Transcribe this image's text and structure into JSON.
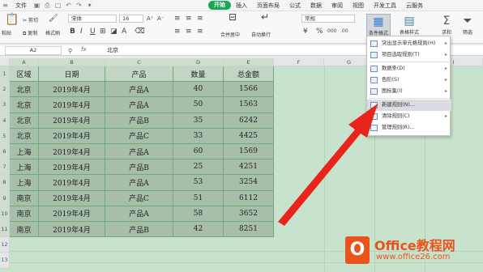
{
  "menubar": {
    "file": "文件",
    "items": [
      "开始",
      "插入",
      "页面布局",
      "公式",
      "数据",
      "审阅",
      "视图",
      "开发工具",
      "云服务"
    ],
    "active_index": 0
  },
  "ribbon": {
    "cut": "剪切",
    "paste": "粘贴",
    "copy": "复制",
    "format_painter": "格式刷",
    "font": "宋体",
    "font_size": "16",
    "merge": "合并居中",
    "wrap": "自动换行",
    "number_format": "常规",
    "conditional_format": "条件格式",
    "table_style": "表格样式",
    "sum": "求和",
    "filter": "筛选"
  },
  "formula_bar": {
    "cell_ref": "A2",
    "fx": "fx",
    "value": "北京"
  },
  "columns": [
    "A",
    "B",
    "C",
    "D",
    "E",
    "F",
    "G",
    "H",
    "I"
  ],
  "rows": [
    "1",
    "2",
    "3",
    "4",
    "5",
    "6",
    "7",
    "8",
    "9",
    "10",
    "11",
    "12",
    "13"
  ],
  "table": {
    "headers": [
      "区域",
      "日期",
      "产品",
      "数量",
      "总金额"
    ],
    "rows": [
      [
        "北京",
        "2019年4月",
        "产品A",
        "40",
        "1566"
      ],
      [
        "北京",
        "2019年4月",
        "产品A",
        "50",
        "1563"
      ],
      [
        "北京",
        "2019年4月",
        "产品B",
        "35",
        "6242"
      ],
      [
        "北京",
        "2019年4月",
        "产品C",
        "33",
        "4425"
      ],
      [
        "上海",
        "2019年4月",
        "产品A",
        "60",
        "1569"
      ],
      [
        "上海",
        "2019年4月",
        "产品B",
        "25",
        "4251"
      ],
      [
        "上海",
        "2019年4月",
        "产品A",
        "53",
        "3254"
      ],
      [
        "南京",
        "2019年4月",
        "产品C",
        "51",
        "6112"
      ],
      [
        "南京",
        "2019年4月",
        "产品A",
        "58",
        "3652"
      ],
      [
        "南京",
        "2019年4月",
        "产品B",
        "42",
        "8251"
      ]
    ]
  },
  "dropdown": {
    "items": [
      {
        "label": "突出显示单元格规则(H)",
        "submenu": true
      },
      {
        "label": "项目选取规则(T)",
        "submenu": true
      },
      {
        "label": "数据条(D)",
        "submenu": true
      },
      {
        "label": "色阶(S)",
        "submenu": true
      },
      {
        "label": "图标集(I)",
        "submenu": true
      },
      {
        "label": "新建规则(N)...",
        "submenu": false
      },
      {
        "label": "清除规则(C)",
        "submenu": true
      },
      {
        "label": "管理规则(R)...",
        "submenu": false
      }
    ],
    "highlighted_index": 5
  },
  "watermark": {
    "title": "Office教程网",
    "url": "www.office26.com",
    "badge_letter": "O"
  },
  "colors": {
    "accent": "#16a951",
    "arrow": "#e8241c",
    "watermark": "#e8541c"
  }
}
